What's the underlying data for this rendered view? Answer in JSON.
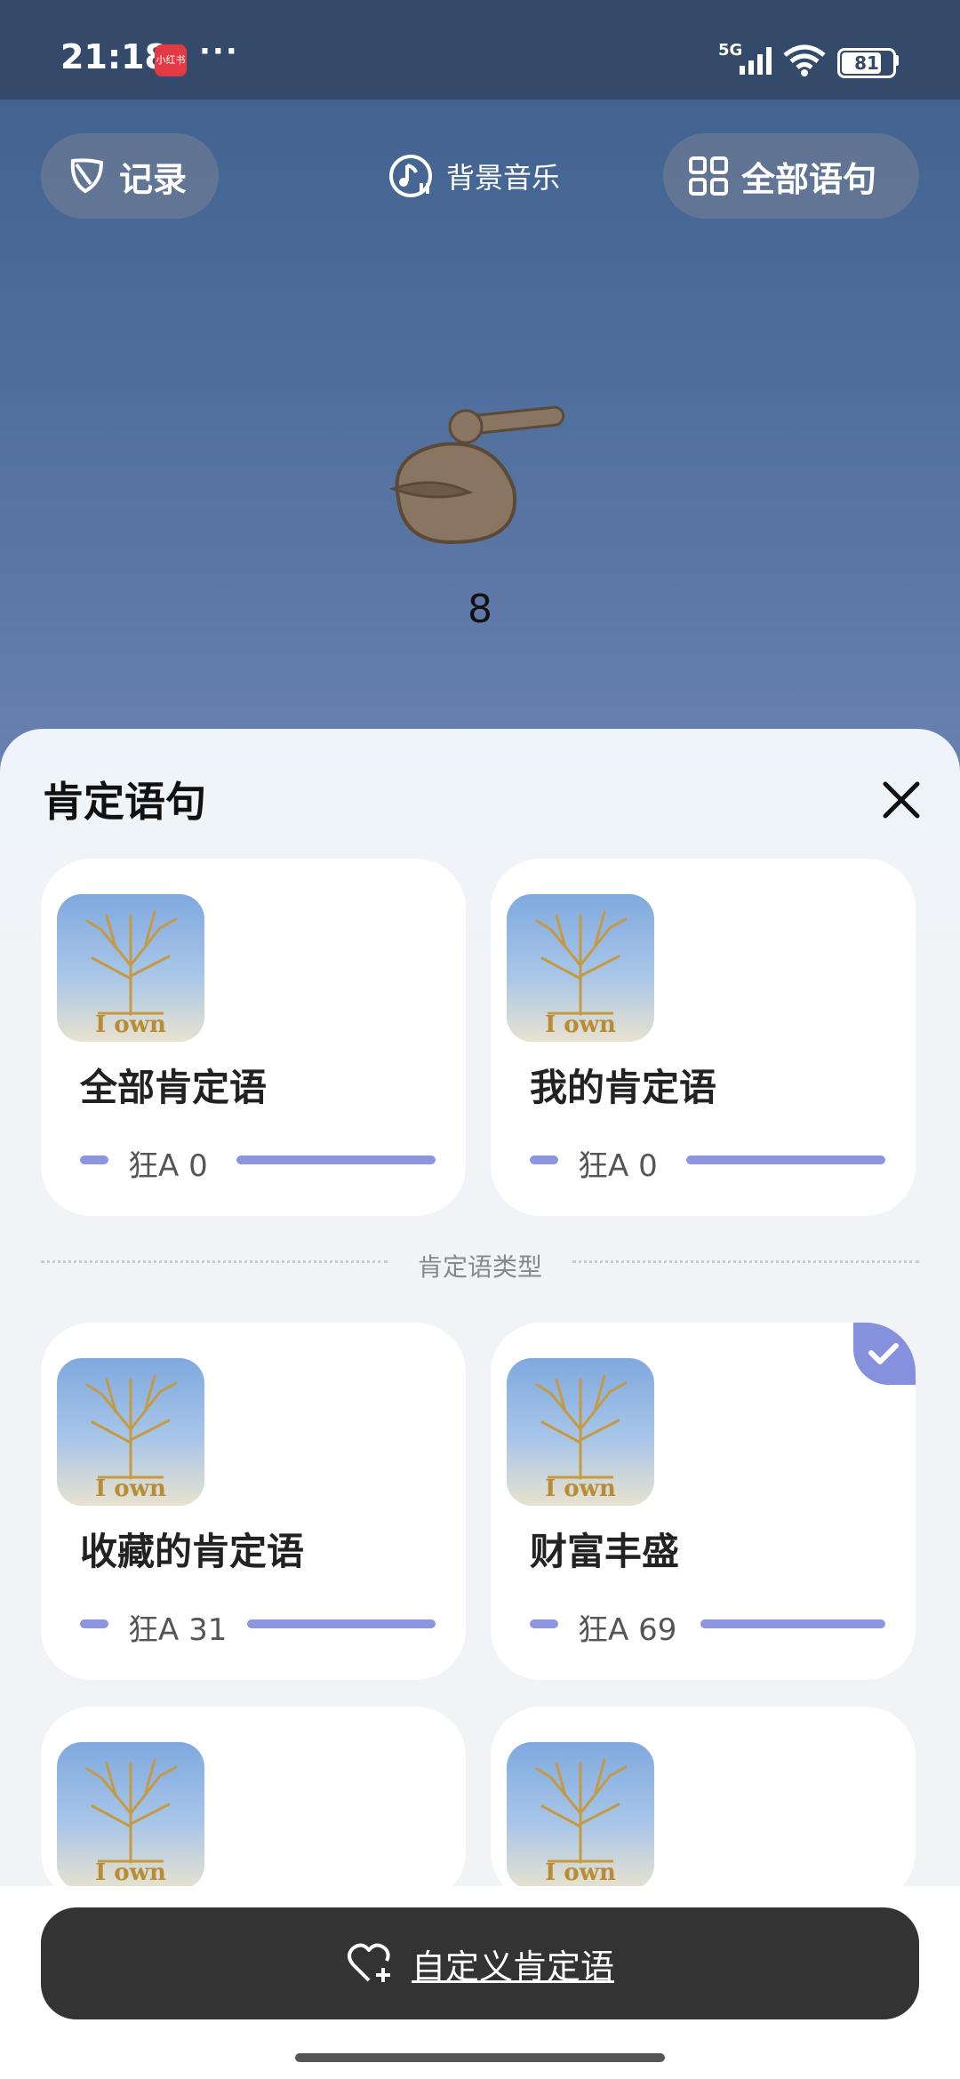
{
  "status_bar": {
    "time": "21:18",
    "app_badge": "小红书",
    "dots": "···",
    "network": "5G",
    "battery": "81"
  },
  "top_bar": {
    "record_label": "记录",
    "music_label": "背景音乐",
    "all_label": "全部语句"
  },
  "main": {
    "counter": "8"
  },
  "sheet": {
    "title": "肯定语句",
    "section_label": "肯定语类型",
    "image_caption": "I own",
    "cards": [
      {
        "title": "全部肯定语",
        "stat": "狂A 0",
        "selected": false
      },
      {
        "title": "我的肯定语",
        "stat": "狂A 0",
        "selected": false
      },
      {
        "title": "收藏的肯定语",
        "stat": "狂A 31",
        "selected": false
      },
      {
        "title": "财富丰盛",
        "stat": "狂A 69",
        "selected": true
      },
      {
        "title": "",
        "stat": "",
        "selected": false
      },
      {
        "title": "",
        "stat": "",
        "selected": false
      }
    ]
  },
  "custom_button": {
    "label": "自定义肯定语"
  },
  "colors": {
    "accent": "#8c95e0",
    "button_dark": "#333333",
    "header_bg": "#4a6a98"
  }
}
